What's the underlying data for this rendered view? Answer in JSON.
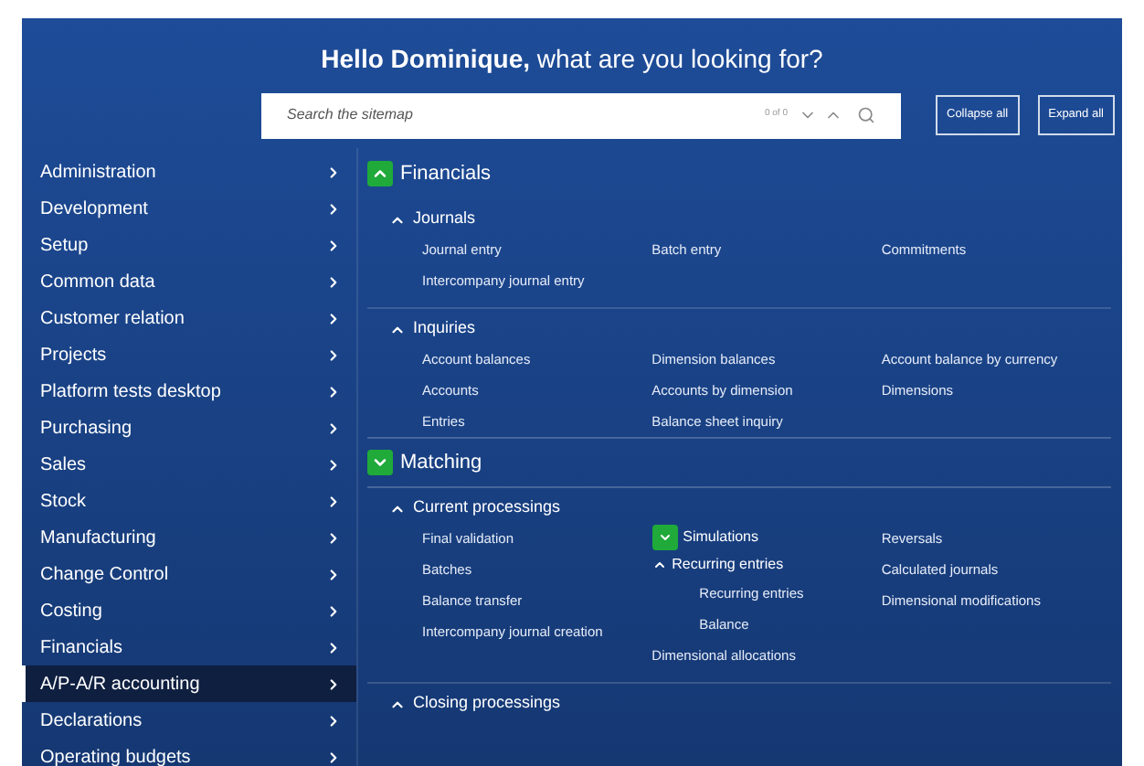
{
  "header": {
    "greeting": "**Hello Dominique,** what are you looking for?"
  },
  "search": {
    "placeholder": "Search the sitemap",
    "counter": "0 of 0"
  },
  "buttons": [
    "Collapse all",
    "Expand all"
  ],
  "sidebar": {
    "items": [
      {
        "label": "Administration",
        "selected": false
      },
      {
        "label": "Development",
        "selected": false
      },
      {
        "label": "Setup",
        "selected": false
      },
      {
        "label": "Common data",
        "selected": false
      },
      {
        "label": "Customer relation",
        "selected": false
      },
      {
        "label": "Projects",
        "selected": false
      },
      {
        "label": "Platform tests desktop",
        "selected": false
      },
      {
        "label": "Purchasing",
        "selected": false
      },
      {
        "label": "Sales",
        "selected": false
      },
      {
        "label": "Stock",
        "selected": false
      },
      {
        "label": "Manufacturing",
        "selected": false
      },
      {
        "label": "Change Control",
        "selected": false
      },
      {
        "label": "Costing",
        "selected": false
      },
      {
        "label": "Financials",
        "selected": false
      },
      {
        "label": "A/P-A/R accounting",
        "selected": true
      },
      {
        "label": "Declarations",
        "selected": false
      },
      {
        "label": "Operating budgets",
        "selected": false
      }
    ]
  },
  "sections": [
    {
      "title": "Financials",
      "expanded": true,
      "highlighted": true,
      "groups": [
        {
          "title": "Journals",
          "expanded": true,
          "columns": [
            [
              {
                "kind": "link",
                "label": "Journal entry"
              },
              {
                "kind": "link",
                "label": "Intercompany journal entry"
              }
            ],
            [
              {
                "kind": "link",
                "label": "Batch entry"
              }
            ],
            [
              {
                "kind": "link",
                "label": "Commitments"
              }
            ]
          ]
        },
        {
          "title": "Inquiries",
          "expanded": true,
          "columns": [
            [
              {
                "kind": "link",
                "label": "Account balances"
              },
              {
                "kind": "link",
                "label": "Accounts"
              },
              {
                "kind": "link",
                "label": "Entries"
              }
            ],
            [
              {
                "kind": "link",
                "label": "Dimension balances"
              },
              {
                "kind": "link",
                "label": "Accounts by dimension"
              },
              {
                "kind": "link",
                "label": "Balance sheet inquiry"
              }
            ],
            [
              {
                "kind": "link",
                "label": "Account balance by currency"
              },
              {
                "kind": "link",
                "label": "Dimensions"
              }
            ]
          ]
        }
      ]
    },
    {
      "title": "Matching",
      "expanded": false,
      "highlighted": true,
      "groups": [
        {
          "title": "Current processings",
          "expanded": true,
          "columns": [
            [
              {
                "kind": "link",
                "label": "Final validation"
              },
              {
                "kind": "link",
                "label": "Batches"
              },
              {
                "kind": "link",
                "label": "Balance transfer"
              },
              {
                "kind": "link",
                "label": "Intercompany journal creation"
              }
            ],
            [
              {
                "kind": "folder",
                "label": "Simulations",
                "expanded": false,
                "highlighted": true
              },
              {
                "kind": "folder",
                "label": "Recurring entries",
                "expanded": true,
                "highlighted": false,
                "children": [
                  {
                    "kind": "link",
                    "label": "Recurring entries"
                  },
                  {
                    "kind": "link",
                    "label": "Balance"
                  }
                ]
              },
              {
                "kind": "link",
                "label": "Dimensional allocations"
              }
            ],
            [
              {
                "kind": "link",
                "label": "Reversals"
              },
              {
                "kind": "link",
                "label": "Calculated journals"
              },
              {
                "kind": "link",
                "label": "Dimensional modifications"
              }
            ]
          ]
        },
        {
          "title": "Closing processings",
          "expanded": true
        }
      ]
    }
  ]
}
